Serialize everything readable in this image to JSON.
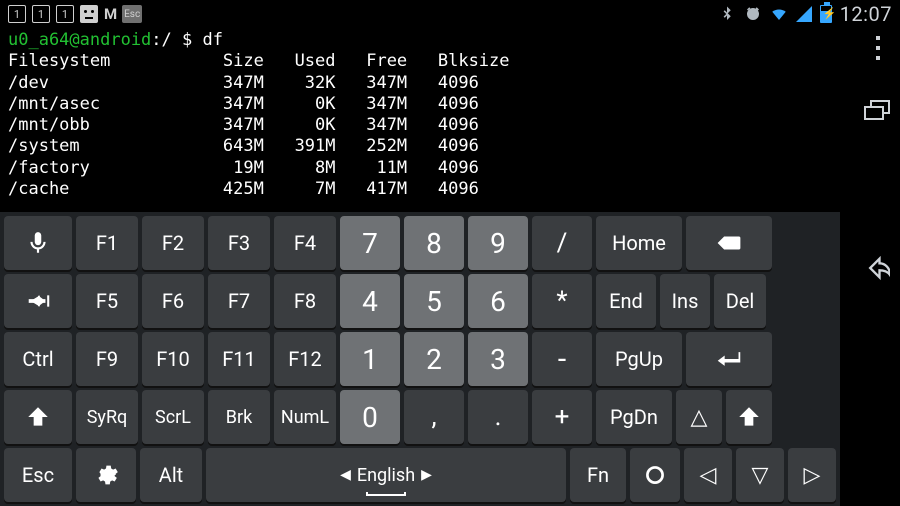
{
  "statusbar": {
    "tray_nums": [
      "1",
      "1",
      "1"
    ],
    "gmail_label": "M",
    "esc_label": "Esc",
    "clock": "12:07"
  },
  "terminal": {
    "prompt_user": "u0_a64@android",
    "prompt_path": ":/ $ ",
    "command": "df",
    "header": "Filesystem           Size   Used   Free   Blksize",
    "rows": [
      "/dev                 347M    32K   347M   4096",
      "/mnt/asec            347M     0K   347M   4096",
      "/mnt/obb             347M     0K   347M   4096",
      "/system              643M   391M   252M   4096",
      "/factory              19M     8M    11M   4096",
      "/cache               425M     7M   417M   4096"
    ]
  },
  "keys": {
    "r1": [
      "F1",
      "F2",
      "F3",
      "F4",
      "7",
      "8",
      "9",
      "/",
      "Home"
    ],
    "r2": [
      "F5",
      "F6",
      "F7",
      "F8",
      "4",
      "5",
      "6",
      "*",
      "End",
      "Ins",
      "Del"
    ],
    "r3": [
      "Ctrl",
      "F9",
      "F10",
      "F11",
      "F12",
      "1",
      "2",
      "3",
      "-",
      "PgUp"
    ],
    "r4": [
      "SyRq",
      "ScrL",
      "Brk",
      "NumL",
      "0",
      ",",
      ".",
      "+",
      "PgDn",
      "△"
    ],
    "r5": [
      "Esc",
      "Alt",
      "Fn"
    ],
    "space_lang": "English",
    "arrows": [
      "◁",
      "▽",
      "▷"
    ]
  }
}
